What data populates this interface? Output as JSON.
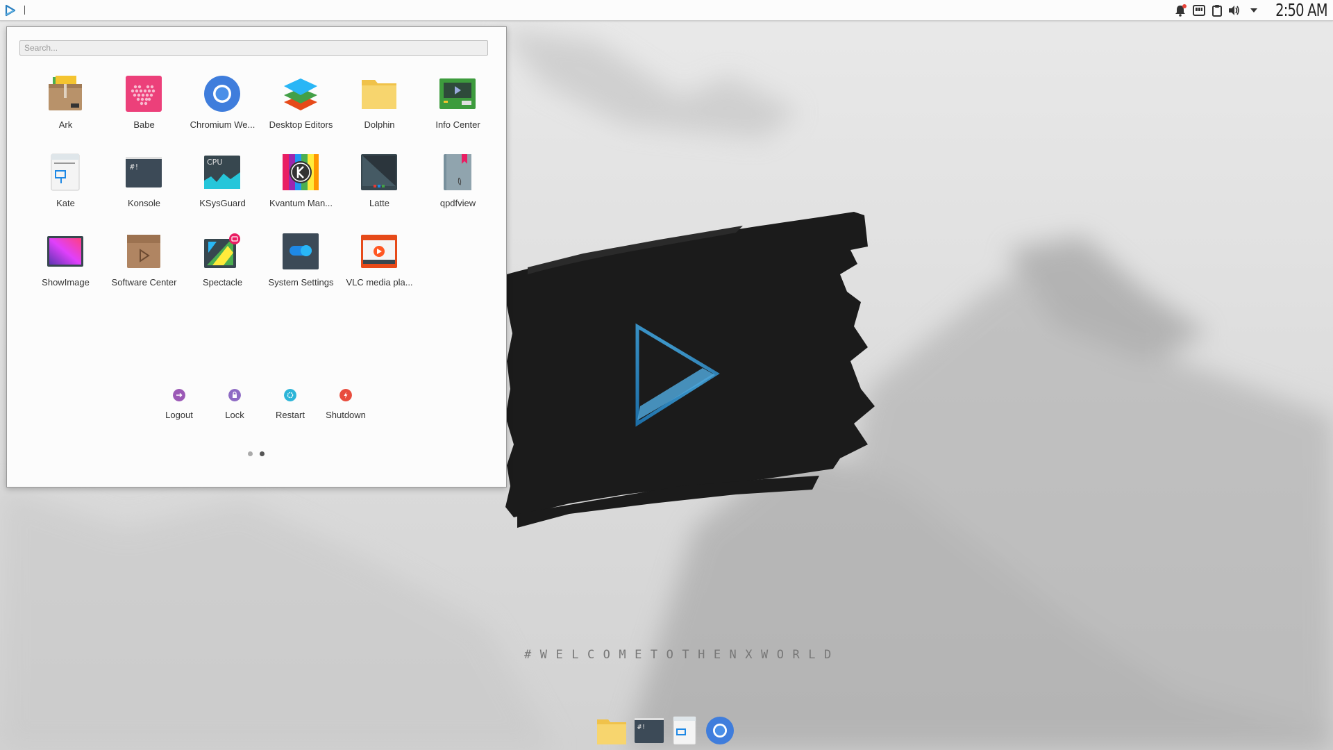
{
  "top_panel": {
    "launcher_icon": "nx-play-icon",
    "tray_icons": [
      "notification-bell-icon",
      "task-switcher-icon",
      "clipboard-icon",
      "volume-icon",
      "tray-expand-arrow-icon"
    ],
    "clock": "2:50 AM"
  },
  "launcher": {
    "search_placeholder": "Search...",
    "apps": [
      {
        "label": "Ark",
        "icon": "archive-box-icon"
      },
      {
        "label": "Babe",
        "icon": "pink-heart-grid-icon"
      },
      {
        "label": "Chromium We...",
        "icon": "chromium-icon"
      },
      {
        "label": "Desktop Editors",
        "icon": "layers-stack-icon"
      },
      {
        "label": "Dolphin",
        "icon": "folder-icon"
      },
      {
        "label": "Info Center",
        "icon": "circuit-board-icon"
      },
      {
        "label": "Kate",
        "icon": "text-editor-icon"
      },
      {
        "label": "Konsole",
        "icon": "terminal-icon"
      },
      {
        "label": "KSysGuard",
        "icon": "cpu-monitor-icon"
      },
      {
        "label": "Kvantum Man...",
        "icon": "kvantum-icon"
      },
      {
        "label": "Latte",
        "icon": "latte-dock-icon"
      },
      {
        "label": "qpdfview",
        "icon": "pdf-book-icon"
      },
      {
        "label": "ShowImage",
        "icon": "image-viewer-icon"
      },
      {
        "label": "Software Center",
        "icon": "software-box-icon"
      },
      {
        "label": "Spectacle",
        "icon": "screenshot-icon"
      },
      {
        "label": "System Settings",
        "icon": "settings-toggle-icon"
      },
      {
        "label": "VLC media pla...",
        "icon": "vlc-player-icon"
      }
    ],
    "power": [
      {
        "label": "Logout",
        "icon": "logout-icon",
        "color": "#9b59b6"
      },
      {
        "label": "Lock",
        "icon": "lock-icon",
        "color": "#8e6bc4"
      },
      {
        "label": "Restart",
        "icon": "restart-icon",
        "color": "#2cb5d8"
      },
      {
        "label": "Shutdown",
        "icon": "shutdown-icon",
        "color": "#e84c3d"
      }
    ],
    "pages": {
      "count": 2,
      "current": 2
    }
  },
  "wallpaper": {
    "tagline": "#WELCOMETOTHENXWORLD"
  },
  "dock": [
    "folder-icon",
    "terminal-icon",
    "text-editor-icon",
    "chromium-icon"
  ],
  "colors": {
    "accent": "#2a7fbf",
    "panel_bg": "#fcfcfc",
    "brush": "#1b1b1b"
  }
}
